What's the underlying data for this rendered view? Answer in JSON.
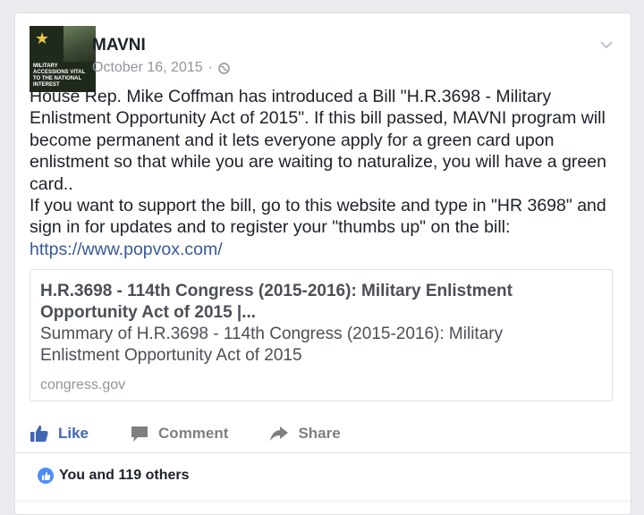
{
  "post": {
    "author": "MAVNI",
    "date": "October 16, 2015",
    "separator": "·",
    "avatar_text": "MILITARY ACCESSIONS VITAL TO THE NATIONAL INTEREST",
    "body_lines": [
      "House Rep. Mike Coffman has introduced a Bill \"H.R.3698 - Military Enlistment Opportunity Act of 2015\". If this bill passed, MAVNI program will become permanent and it lets everyone apply for a green card upon enlistment so that while you are waiting to naturalize, you will have a green card..",
      "If you want to support the bill, go to this website and type in \"HR 3698\" and sign in for updates and to register your \"thumbs up\" on the bill:"
    ],
    "link_text": "https://www.popvox.com/"
  },
  "preview": {
    "title": "H.R.3698 - 114th Congress (2015-2016): Military Enlistment Opportunity Act of 2015 |...",
    "description": "Summary of H.R.3698 - 114th Congress (2015-2016): Military Enlistment Opportunity Act of 2015",
    "domain": "congress.gov"
  },
  "actions": {
    "like": "Like",
    "comment": "Comment",
    "share": "Share"
  },
  "reactions": {
    "summary": "You and 119 others"
  },
  "colors": {
    "link": "#385898",
    "like_active": "#4267b2",
    "muted": "#90949c"
  },
  "icons": [
    "chevron-down-icon",
    "globe-icon",
    "like-icon",
    "comment-icon",
    "share-icon",
    "like-reaction-icon",
    "army-star-icon"
  ]
}
